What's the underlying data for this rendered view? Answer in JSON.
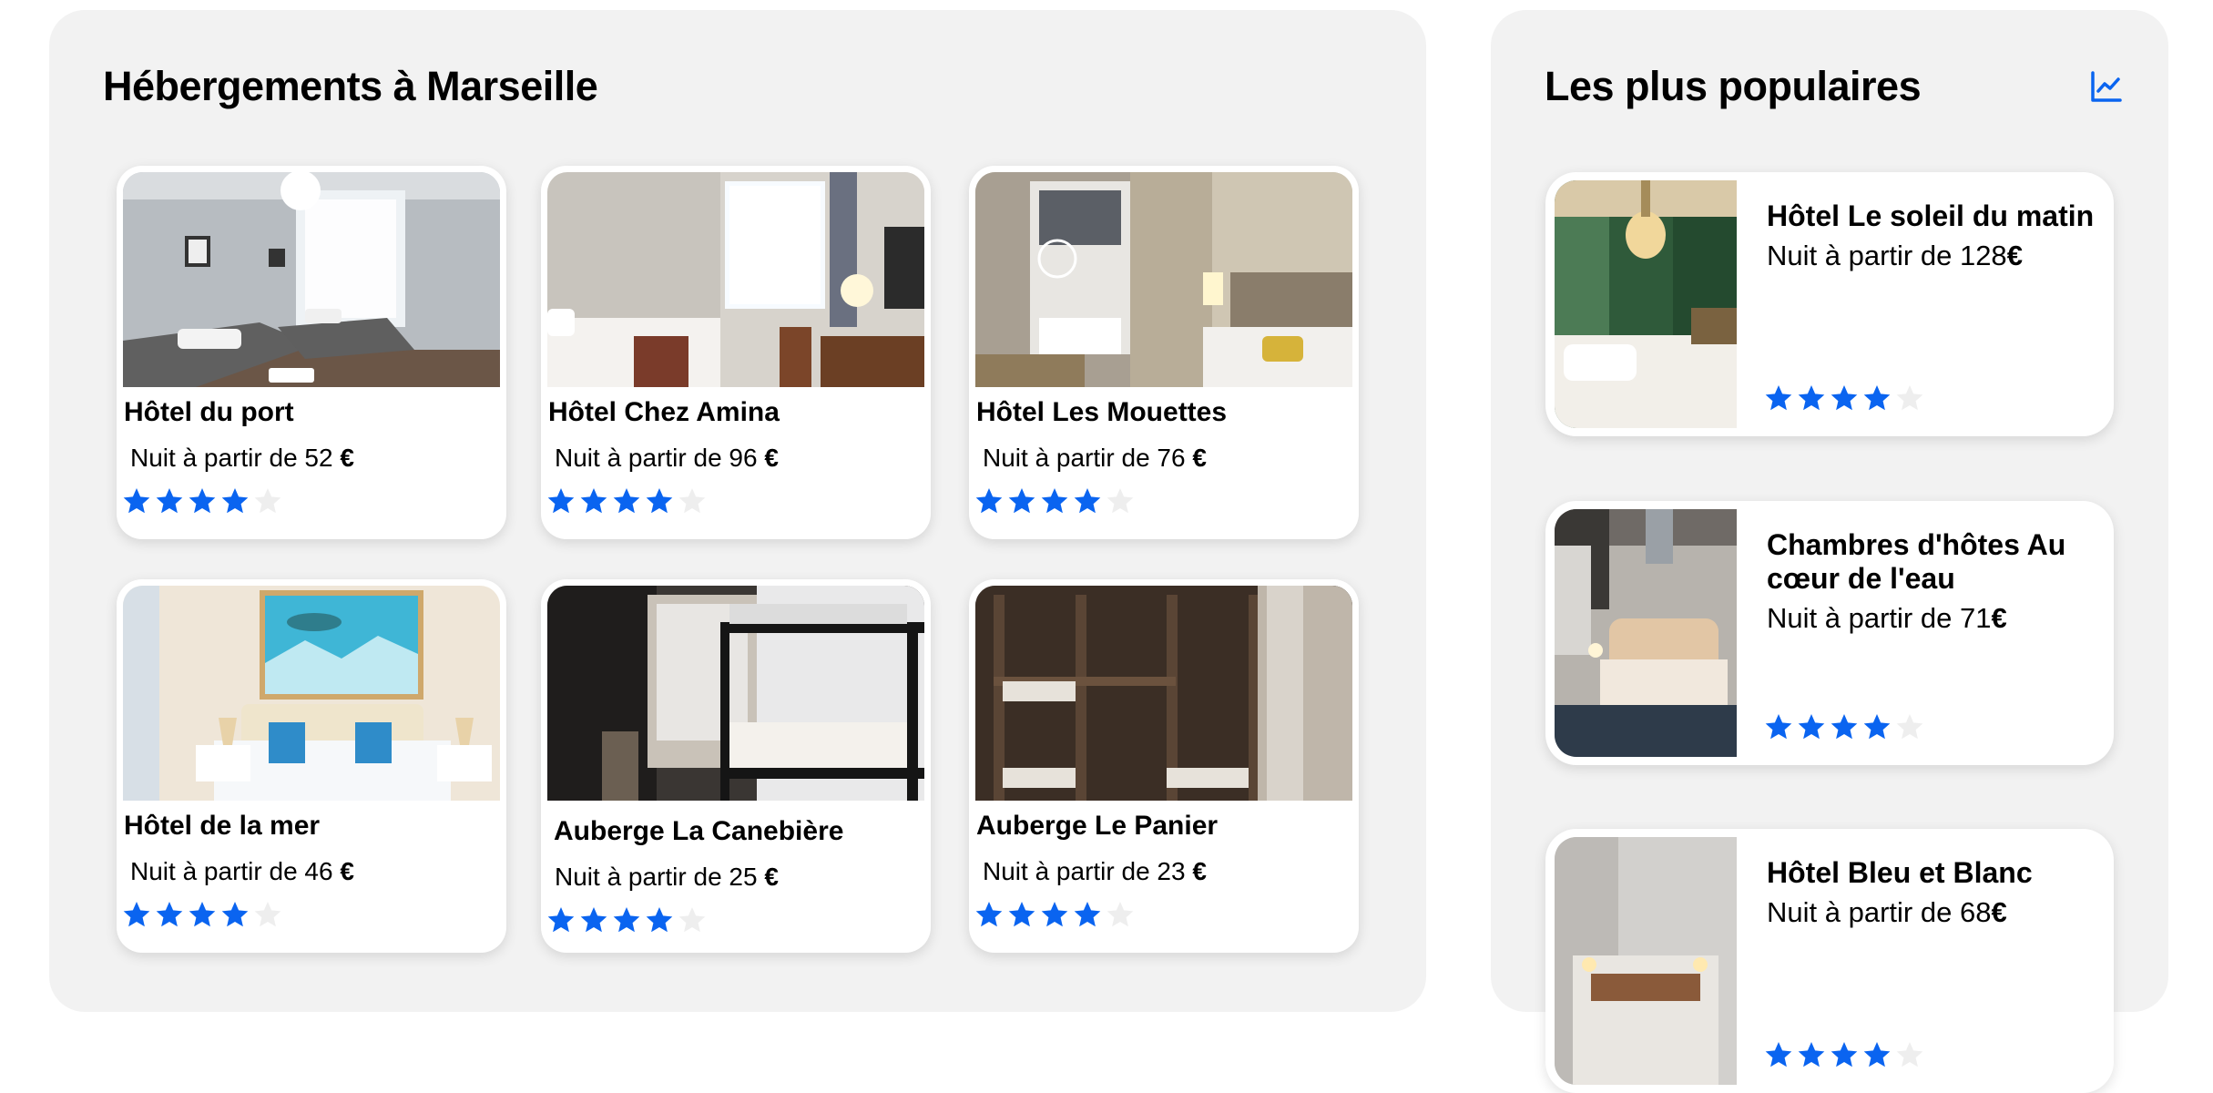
{
  "colors": {
    "accent": "#0a64f0",
    "star_empty": "#eeeeee",
    "panel": "#f2f2f2"
  },
  "listing": {
    "title": "Hébergements à Marseille",
    "price_prefix": "Nuit à partir de",
    "currency": "€",
    "hotels": [
      {
        "name": "Hôtel du port",
        "price": "52",
        "rating": 4,
        "stars_max": 5,
        "photo": "bright-twin-room"
      },
      {
        "name": "Hôtel Chez Amina",
        "price": "96",
        "rating": 4,
        "stars_max": 5,
        "photo": "room-with-window-and-desk"
      },
      {
        "name": "Hôtel Les Mouettes",
        "price": "76",
        "rating": 4,
        "stars_max": 5,
        "photo": "room-with-mirror-wardrobe"
      },
      {
        "name": "Hôtel de la mer",
        "price": "46",
        "rating": 4,
        "stars_max": 5,
        "photo": "seaside-room-with-wave-painting"
      },
      {
        "name": "Auberge La Canebière",
        "price": "25",
        "rating": 4,
        "stars_max": 5,
        "photo": "bunk-bed-dorm"
      },
      {
        "name": "Auberge Le Panier",
        "price": "23",
        "rating": 4,
        "stars_max": 5,
        "photo": "wooden-bunk-dorm"
      }
    ]
  },
  "popular": {
    "title": "Les plus populaires",
    "icon": "trending-chart-icon",
    "price_prefix": "Nuit à partir de",
    "currency": "€",
    "hotels": [
      {
        "name": "Hôtel Le soleil du matin",
        "price": "128",
        "rating": 4,
        "stars_max": 5,
        "photo": "green-room-with-chandelier"
      },
      {
        "name": "Chambres d'hôtes Au cœur de l'eau",
        "price": "71",
        "rating": 4,
        "stars_max": 5,
        "photo": "room-with-tufted-headboard"
      },
      {
        "name": "Hôtel Bleu et Blanc",
        "price": "68",
        "rating": 4,
        "stars_max": 5,
        "photo": "white-room-with-lamps"
      }
    ]
  }
}
